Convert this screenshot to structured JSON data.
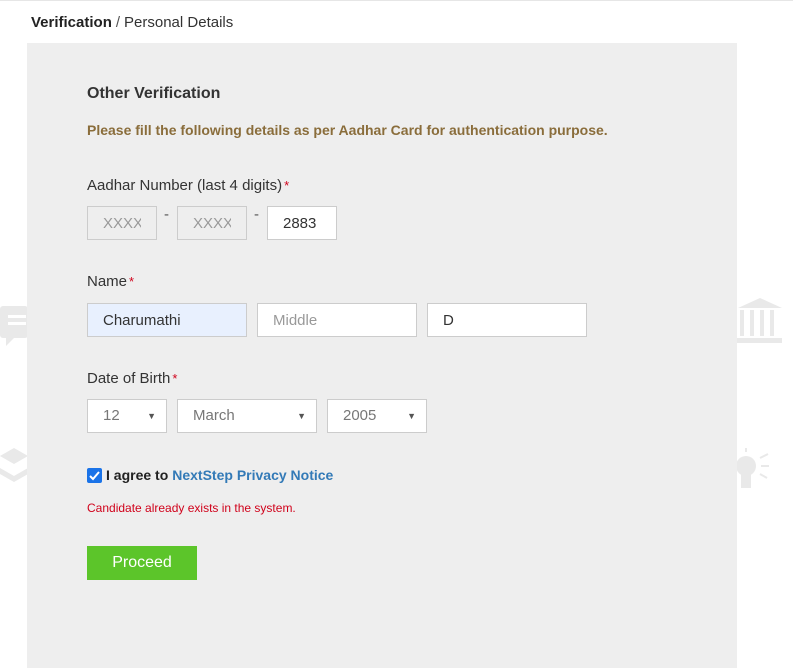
{
  "breadcrumb": {
    "active": "Verification",
    "separator": "/",
    "current": "Personal Details"
  },
  "form": {
    "title": "Other Verification",
    "instruction": "Please fill the following details as per Aadhar Card for authentication purpose.",
    "required_marker": "*",
    "aadhar": {
      "label": "Aadhar Number (last 4 digits)",
      "part1_placeholder": "XXXX",
      "part2_placeholder": "XXXX",
      "part3_value": "2883",
      "dash": "-"
    },
    "name": {
      "label": "Name",
      "first_value": "Charumathi",
      "middle_placeholder": "Middle",
      "last_value": "D"
    },
    "dob": {
      "label": "Date of Birth",
      "day": "12",
      "month": "March",
      "year": "2005"
    },
    "agree": {
      "checked": true,
      "text": "I agree to",
      "link": "NextStep Privacy Notice"
    },
    "error": "Candidate already exists in the system.",
    "proceed_label": "Proceed"
  },
  "colors": {
    "panel_bg": "#eeeeee",
    "instruction": "#8a6d3b",
    "link": "#337ab7",
    "error": "#d0021b",
    "proceed_bg": "#5cc52a",
    "checkbox": "#1a73e8"
  },
  "decor_icons": [
    "chat-icon",
    "layers-icon",
    "bank-icon",
    "lightbulb-icon"
  ]
}
